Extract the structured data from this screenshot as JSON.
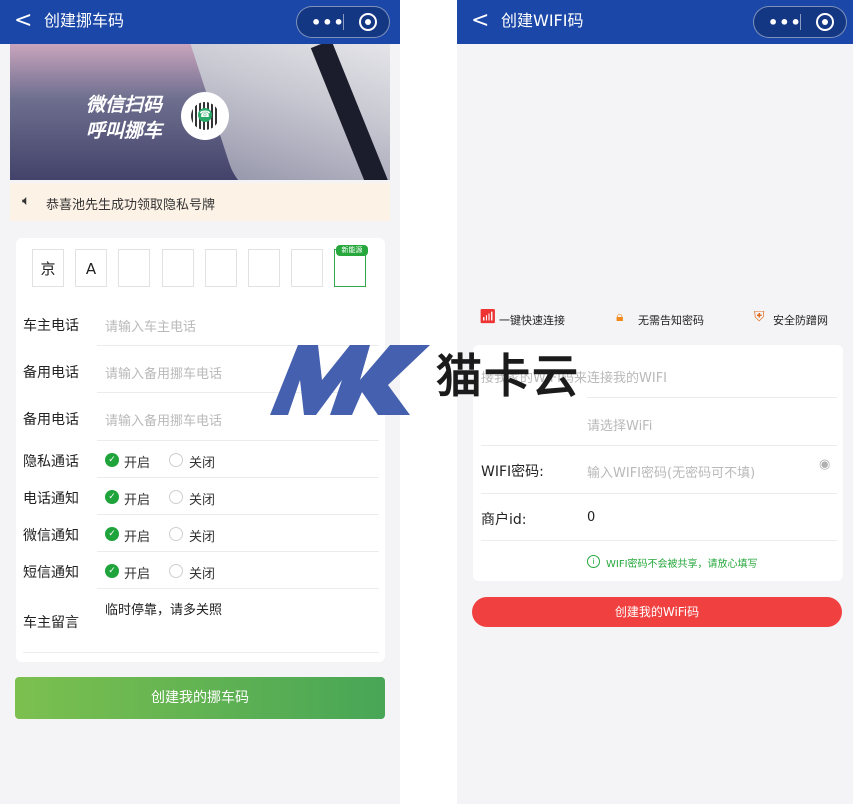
{
  "left": {
    "nav": {
      "back": "<",
      "title": "创建挪车码",
      "more": "•••"
    },
    "banner": {
      "line1": "微信扫码",
      "line2": "呼叫挪车"
    },
    "notice": {
      "icon": "speaker-icon",
      "text": "恭喜池先生成功领取隐私号牌"
    },
    "plate": {
      "cells": [
        "京",
        "A",
        "",
        "",
        "",
        "",
        "",
        ""
      ],
      "new_energy_badge": "新能源"
    },
    "fields": [
      {
        "label": "车主电话",
        "placeholder": "请输入车主电话"
      },
      {
        "label": "备用电话",
        "placeholder": "请输入备用挪车电话"
      },
      {
        "label": "备用电话",
        "placeholder": "请输入备用挪车电话"
      }
    ],
    "toggles": [
      {
        "label": "隐私通话",
        "on": "开启",
        "off": "关闭",
        "selected": "on"
      },
      {
        "label": "电话通知",
        "on": "开启",
        "off": "关闭",
        "selected": "on"
      },
      {
        "label": "微信通知",
        "on": "开启",
        "off": "关闭",
        "selected": "on"
      },
      {
        "label": "短信通知",
        "on": "开启",
        "off": "关闭",
        "selected": "on"
      }
    ],
    "message": {
      "label": "车主留言",
      "value": "临时停靠，请多关照"
    },
    "submit": "创建我的挪车码"
  },
  "right": {
    "nav": {
      "back": "<",
      "title": "创建WIFI码",
      "more": "•••"
    },
    "features": [
      {
        "icon": "wifi-icon",
        "label": "一键快速连接"
      },
      {
        "icon": "lock-icon",
        "label": "无需告知密码"
      },
      {
        "icon": "shield-icon",
        "label": "安全防蹭网"
      }
    ],
    "intro": "接我家的WIFI码来连接我的WIFI",
    "wifi_select": {
      "placeholder": "请选择WiFi"
    },
    "password": {
      "label": "WIFI密码:",
      "placeholder": "输入WIFI密码(无密码可不填)"
    },
    "merchant": {
      "label": "商户id:",
      "value": "0"
    },
    "tip": "WIFI密码不会被共享，请放心填写",
    "submit": "创建我的WiFi码"
  },
  "watermark": {
    "text": "猫卡云"
  },
  "colors": {
    "nav": "#1a47a8",
    "green": "#27a83d",
    "red": "#f0403f"
  }
}
